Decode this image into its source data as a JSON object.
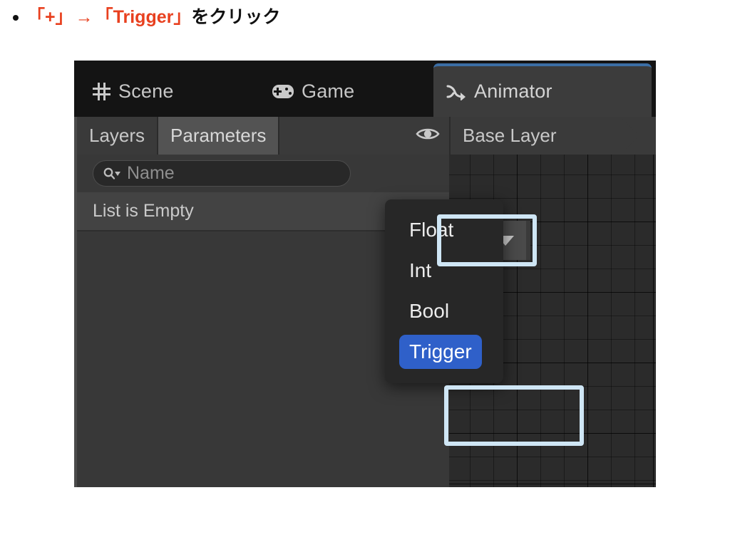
{
  "heading": {
    "bullet_icon": "bullet-dot",
    "segments": [
      {
        "text": "「+」",
        "style": "red"
      },
      {
        "text": "→",
        "style": "arrow"
      },
      {
        "text": "「Trigger」",
        "style": "red"
      },
      {
        "text": "をクリック",
        "style": "black"
      }
    ],
    "full_text": "「+」→「Trigger」をクリック"
  },
  "window": {
    "tabs": [
      {
        "label": "Scene",
        "icon": "grid-icon",
        "active": false
      },
      {
        "label": "Game",
        "icon": "gamepad-icon",
        "active": false
      },
      {
        "label": "Animator",
        "icon": "animator-arrow-icon",
        "active": true
      }
    ],
    "active_tab_accent": "#3b6ea5"
  },
  "parameters_panel": {
    "subtabs": [
      {
        "label": "Layers",
        "active": false
      },
      {
        "label": "Parameters",
        "active": true
      }
    ],
    "eye_icon": "eye-icon",
    "search": {
      "icon": "search-dropdown-icon",
      "value": "",
      "placeholder": "Name"
    },
    "add_button": {
      "plus_icon": "plus-icon",
      "caret_icon": "chevron-down-icon"
    },
    "list_empty_label": "List is Empty"
  },
  "graph_panel": {
    "breadcrumb": "Base Layer",
    "grid_background": "#2b2b2b"
  },
  "dropdown": {
    "items": [
      {
        "label": "Float",
        "selected": false
      },
      {
        "label": "Int",
        "selected": false
      },
      {
        "label": "Bool",
        "selected": false
      },
      {
        "label": "Trigger",
        "selected": true
      }
    ],
    "selected_color": "#2f60c9"
  },
  "callouts": {
    "highlight_color": "#cfe6f5",
    "targets": [
      "add-button",
      "trigger-menu-item"
    ]
  }
}
